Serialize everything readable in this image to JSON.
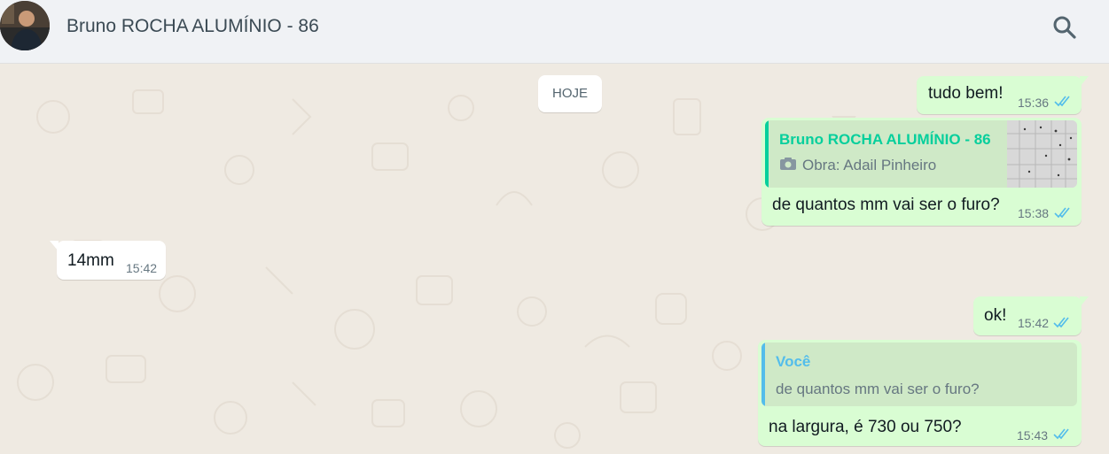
{
  "header": {
    "contact_name": "Bruno ROCHA ALUMÍNIO - 86",
    "avatar_icon": "avatar-photo",
    "search_icon": "search-icon"
  },
  "chat": {
    "day_separator": "HOJE",
    "messages": [
      {
        "direction": "out",
        "text": "tudo bem!",
        "time": "15:36",
        "status": "read"
      },
      {
        "direction": "out",
        "text": "de quantos mm vai ser o furo?",
        "time": "15:38",
        "status": "read",
        "quote": {
          "author": "Bruno ROCHA ALUMÍNIO - 86",
          "text": "Obra: Adail Pinheiro",
          "icon": "camera-icon",
          "has_thumbnail": true
        }
      },
      {
        "direction": "in",
        "text": "14mm",
        "time": "15:42"
      },
      {
        "direction": "out",
        "text": "ok!",
        "time": "15:42",
        "status": "read"
      },
      {
        "direction": "out",
        "text": "na largura, é 730 ou 750?",
        "time": "15:43",
        "status": "read",
        "quote": {
          "author": "Você",
          "text": "de quantos mm vai ser o furo?"
        }
      }
    ]
  },
  "colors": {
    "outgoing_bubble": "#d9fdd3",
    "incoming_bubble": "#ffffff",
    "quote_author_contact": "#06cf9c",
    "quote_author_self": "#53bdeb",
    "read_ticks": "#53bdeb",
    "chat_background": "#efeae2",
    "header_background": "#f0f2f5"
  }
}
